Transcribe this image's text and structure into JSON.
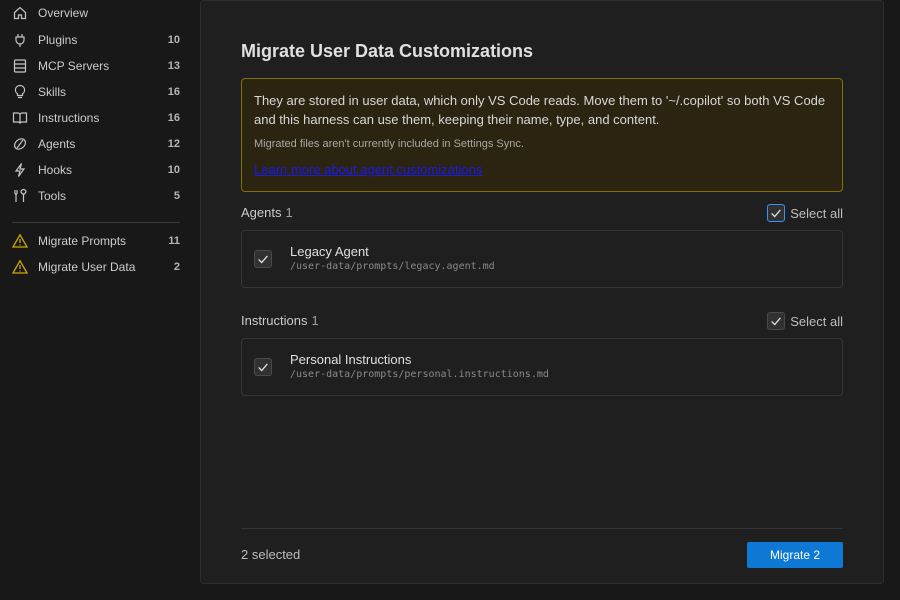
{
  "sidebar": {
    "items": [
      {
        "label": "Overview",
        "count": "",
        "icon": "home-icon"
      },
      {
        "label": "Plugins",
        "count": "10",
        "icon": "plug-icon"
      },
      {
        "label": "MCP Servers",
        "count": "13",
        "icon": "server-icon"
      },
      {
        "label": "Skills",
        "count": "16",
        "icon": "lightbulb-icon"
      },
      {
        "label": "Instructions",
        "count": "16",
        "icon": "book-icon"
      },
      {
        "label": "Agents",
        "count": "12",
        "icon": "agent-icon"
      },
      {
        "label": "Hooks",
        "count": "10",
        "icon": "lightning-icon"
      },
      {
        "label": "Tools",
        "count": "5",
        "icon": "tools-icon"
      }
    ],
    "migrate_items": [
      {
        "label": "Migrate Prompts",
        "count": "11",
        "icon": "warning-icon"
      },
      {
        "label": "Migrate User Data",
        "count": "2",
        "icon": "warning-icon"
      }
    ]
  },
  "main": {
    "title": "Migrate User Data Customizations",
    "notice": {
      "text": "They are stored in user data, which only VS Code reads. Move them to '~/.copilot' so both VS Code and this harness can use them, keeping their name, type, and content.",
      "subtext": "Migrated files aren't currently included in Settings Sync.",
      "link": "Learn more about agent customizations"
    },
    "sections": [
      {
        "title": "Agents",
        "count": "1",
        "select_all": "Select all",
        "items": [
          {
            "name": "Legacy Agent",
            "path": "/user-data/prompts/legacy.agent.md",
            "checked": true
          }
        ]
      },
      {
        "title": "Instructions",
        "count": "1",
        "select_all": "Select all",
        "items": [
          {
            "name": "Personal Instructions",
            "path": "/user-data/prompts/personal.instructions.md",
            "checked": true
          }
        ]
      }
    ],
    "footer": {
      "selected": "2 selected",
      "button": "Migrate 2"
    }
  },
  "colors": {
    "accent": "#0e78d5",
    "warning": "#cca700",
    "notice_border": "#857000",
    "link": "#1a1aee"
  }
}
